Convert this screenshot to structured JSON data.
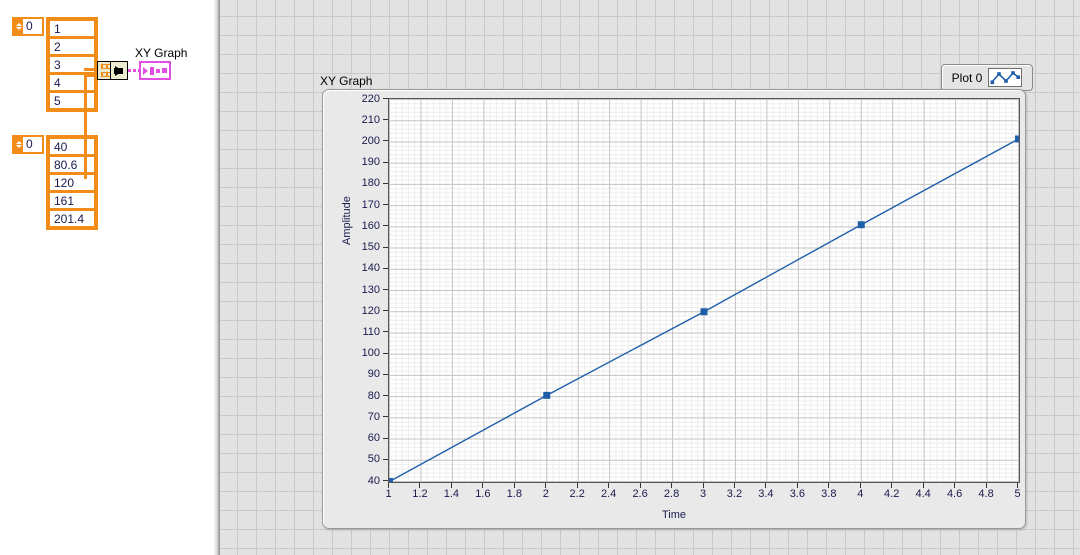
{
  "block_diagram": {
    "x_array": {
      "index_value": "0",
      "values": [
        "1",
        "2",
        "3",
        "4",
        "5"
      ]
    },
    "y_array": {
      "index_value": "0",
      "values": [
        "40",
        "80.6",
        "120",
        "161",
        "201.4"
      ]
    },
    "bundle_node": {
      "name": "bundle-function"
    },
    "xy_graph_terminal": {
      "label": "XY Graph"
    }
  },
  "front_panel": {
    "graph_title": "XY Graph",
    "legend": {
      "label": "Plot 0",
      "style_icon": "line-with-square-markers-icon"
    }
  },
  "chart_data": {
    "type": "line",
    "title": "XY Graph",
    "xlabel": "Time",
    "ylabel": "Amplitude",
    "xlim": [
      1,
      5
    ],
    "ylim": [
      40,
      220
    ],
    "grid": true,
    "legend_position": "top-right",
    "marker": "square",
    "line_color": "#1f5fa9",
    "x_ticks": [
      "1",
      "1.2",
      "1.4",
      "1.6",
      "1.8",
      "2",
      "2.2",
      "2.4",
      "2.6",
      "2.8",
      "3",
      "3.2",
      "3.4",
      "3.6",
      "3.8",
      "4",
      "4.2",
      "4.4",
      "4.6",
      "4.8",
      "5"
    ],
    "y_ticks": [
      "220",
      "210",
      "200",
      "190",
      "180",
      "170",
      "160",
      "150",
      "140",
      "130",
      "120",
      "110",
      "100",
      "90",
      "80",
      "70",
      "60",
      "50",
      "40"
    ],
    "series": [
      {
        "name": "Plot 0",
        "x": [
          1,
          2,
          3,
          4,
          5
        ],
        "y": [
          40,
          80.6,
          120,
          161,
          201.4
        ]
      }
    ]
  }
}
